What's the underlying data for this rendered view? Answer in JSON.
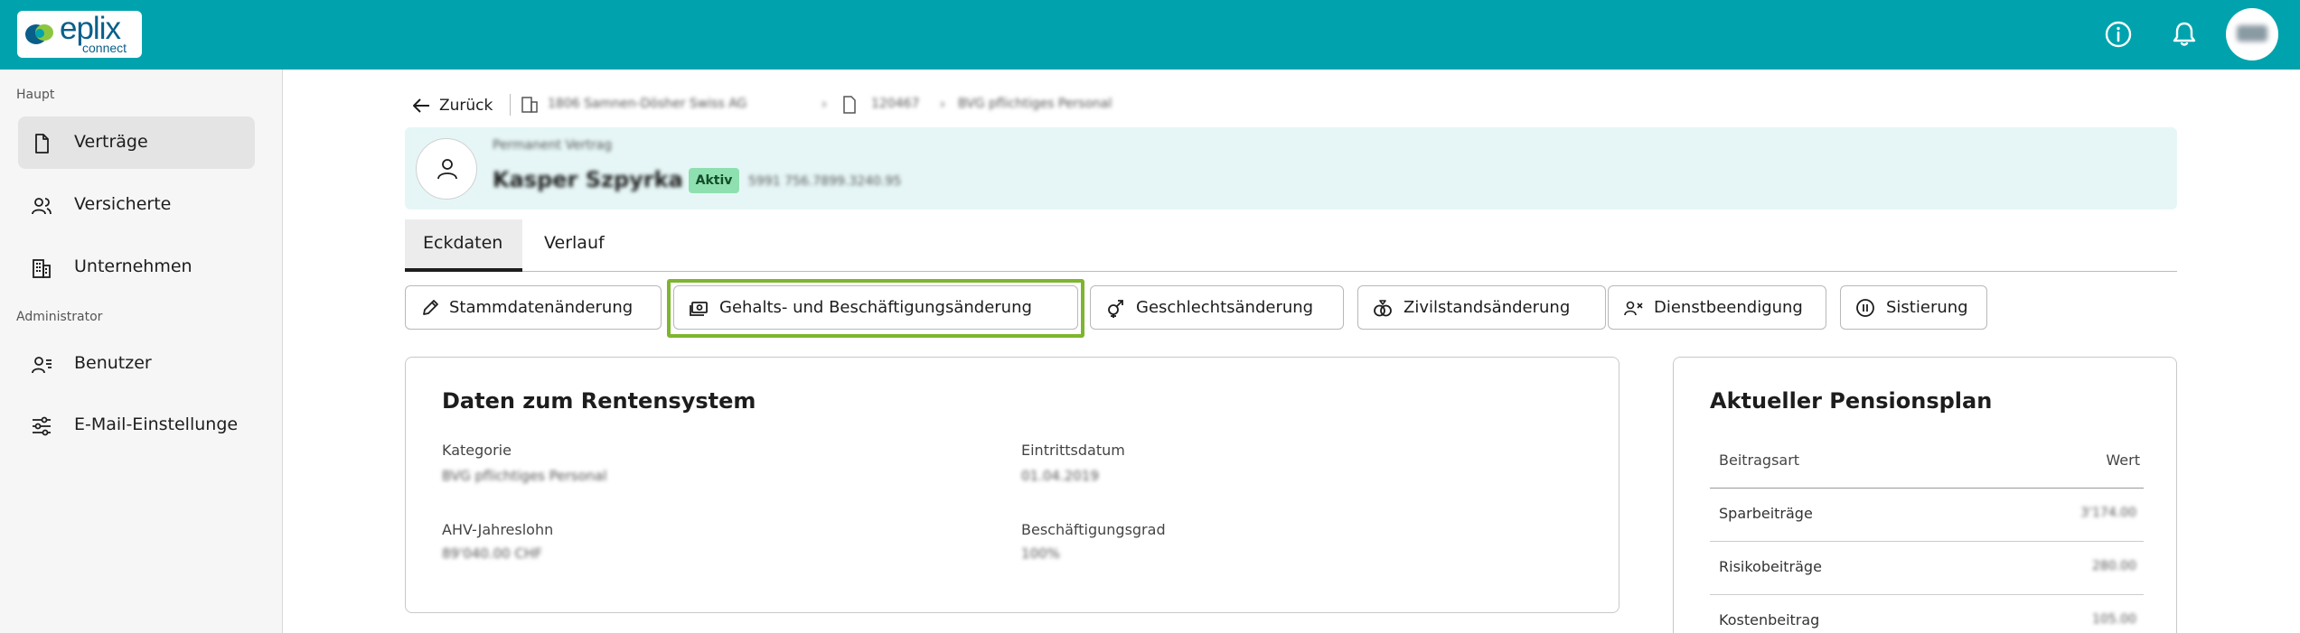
{
  "app": {
    "logo_word": "eplix",
    "logo_sub": "connect",
    "user_initials": "HI",
    "brand_color": "#00a3ad"
  },
  "sidebar": {
    "section_main": "Haupt",
    "section_admin": "Administrator",
    "items": [
      {
        "label": "Verträge",
        "icon": "document-icon",
        "active": true
      },
      {
        "label": "Versicherte",
        "icon": "people-icon"
      },
      {
        "label": "Unternehmen",
        "icon": "building-icon"
      },
      {
        "label": "Benutzer",
        "icon": "user-list-icon"
      },
      {
        "label": "E-Mail-Einstellunge",
        "icon": "sliders-icon"
      }
    ]
  },
  "nav": {
    "back_label": "Zurück",
    "breadcrumb": [
      "1806 Samnen-Dösher Swiss AG",
      "120467",
      "BVG pflichtiges Personal"
    ]
  },
  "header": {
    "contract_label": "Permanent Vertrag",
    "person_name": "Kasper Szpyrka",
    "status": "Aktiv",
    "ahv_number": "5991 756.7899.3240.95"
  },
  "tabs": [
    "Eckdaten",
    "Verlauf"
  ],
  "actions": [
    {
      "label": "Stammdatenänderung",
      "icon": "pencil-icon"
    },
    {
      "label": "Gehalts- und Beschäftigungsänderung",
      "icon": "cash-icon"
    },
    {
      "label": "Geschlechtsänderung",
      "icon": "gender-icon"
    },
    {
      "label": "Zivilstandsänderung",
      "icon": "rings-icon"
    },
    {
      "label": "Dienstbeendigung",
      "icon": "user-remove-icon"
    },
    {
      "label": "Sistierung",
      "icon": "pause-icon"
    }
  ],
  "pension_data": {
    "title": "Daten zum Rentensystem",
    "fields": [
      {
        "label": "Kategorie",
        "value": "BVG pflichtiges Personal"
      },
      {
        "label": "Eintrittsdatum",
        "value": "01.04.2019"
      },
      {
        "label": "AHV-Jahreslohn",
        "value": "89'040.00 CHF"
      },
      {
        "label": "Beschäftigungsgrad",
        "value": "100%"
      }
    ]
  },
  "pension_plan": {
    "title": "Aktueller Pensionsplan",
    "col_type": "Beitragsart",
    "col_value": "Wert",
    "rows": [
      {
        "label": "Sparbeiträge",
        "value": "3'174.00"
      },
      {
        "label": "Risikobeiträge",
        "value": "280.00"
      },
      {
        "label": "Kostenbeitrag",
        "value": "105.00"
      }
    ]
  }
}
